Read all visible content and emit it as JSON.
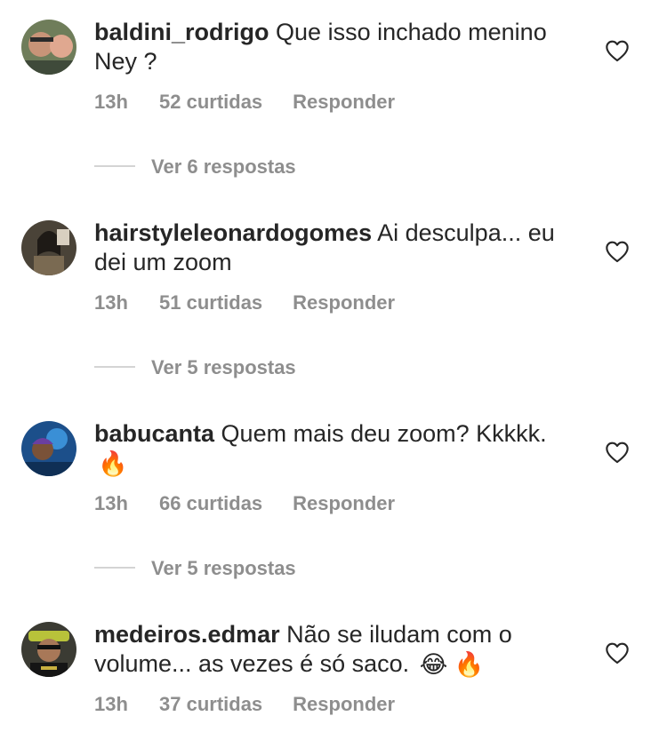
{
  "comments": [
    {
      "username": "baldini_rodrigo",
      "text": "Que isso inchado menino Ney ?",
      "time": "13h",
      "likes": "52 curtidas",
      "reply": "Responder",
      "replies": "Ver 6 respostas",
      "avatar_icon": "avatar-photo"
    },
    {
      "username": "hairstyleleonardogomes",
      "text": "Ai desculpa... eu dei um zoom",
      "time": "13h",
      "likes": "51 curtidas",
      "reply": "Responder",
      "replies": "Ver 5 respostas",
      "avatar_icon": "avatar-photo"
    },
    {
      "username": "babucanta",
      "text": "Quem mais deu zoom? Kkkkk.",
      "emoji": "🔥",
      "time": "13h",
      "likes": "66 curtidas",
      "reply": "Responder",
      "replies": "Ver 5 respostas",
      "avatar_icon": "avatar-photo"
    },
    {
      "username": "medeiros.edmar",
      "text": "Não se iludam com o volume... as vezes é só saco.",
      "emoji": "😂 🔥",
      "time": "13h",
      "likes": "37 curtidas",
      "reply": "Responder",
      "avatar_icon": "avatar-photo"
    }
  ],
  "colors": {
    "text": "#262626",
    "meta": "#8e8e8e",
    "divider": "#d4d4d4"
  },
  "icons": {
    "like": "heart-outline-icon",
    "fire": "fire-emoji-icon",
    "laugh": "tears-of-joy-emoji-icon"
  }
}
